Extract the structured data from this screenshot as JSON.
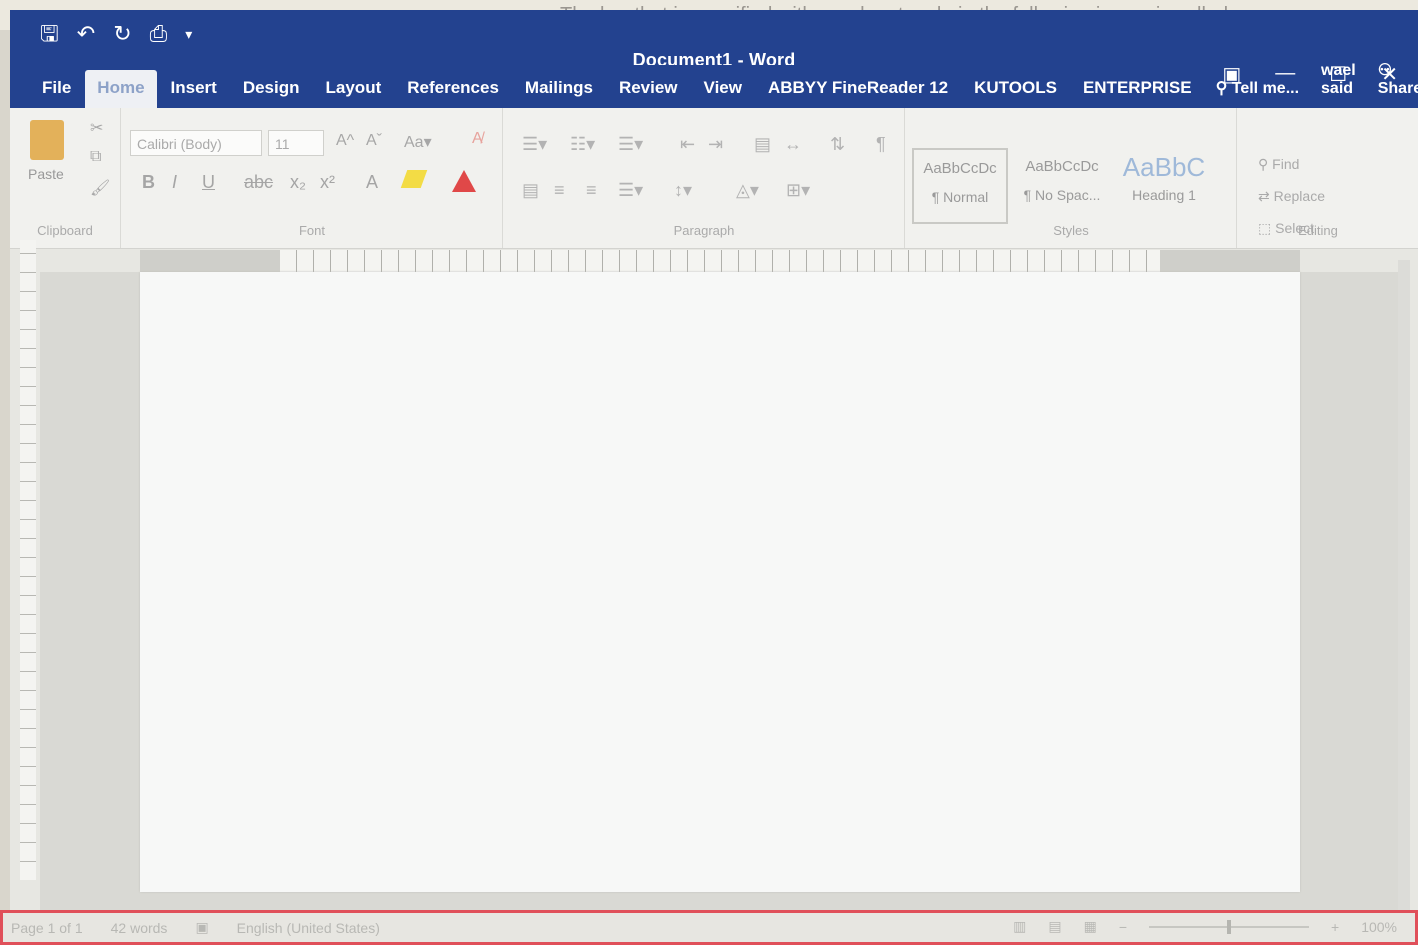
{
  "question_text": "The bar that is specified with a red rectangle in the following image is called",
  "window": {
    "title": "Document1 - Word"
  },
  "quick_access": {
    "icons": [
      "save-icon",
      "undo-icon",
      "redo-icon",
      "print-icon",
      "customize-icon"
    ]
  },
  "tabs": [
    "File",
    "Home",
    "Insert",
    "Design",
    "Layout",
    "References",
    "Mailings",
    "Review",
    "View",
    "ABBYY FineReader 12",
    "KUTOOLS",
    "ENTERPRISE"
  ],
  "active_tab": "Home",
  "tell_me": "Tell me...",
  "user_name": "wael said",
  "share_label": "Share",
  "ribbon": {
    "clipboard": {
      "paste_label": "Paste",
      "group_label": "Clipboard"
    },
    "font": {
      "font_name": "Calibri (Body)",
      "font_size": "11",
      "group_label": "Font"
    },
    "paragraph": {
      "group_label": "Paragraph"
    },
    "styles": {
      "group_label": "Styles",
      "items": [
        {
          "sample": "AaBbCcDc",
          "name": "¶ Normal"
        },
        {
          "sample": "AaBbCcDc",
          "name": "¶ No Spac..."
        },
        {
          "sample": "AaBbC",
          "name": "Heading 1"
        }
      ]
    },
    "editing": {
      "group_label": "Editing",
      "items": [
        "Find",
        "Replace",
        "Select"
      ]
    }
  },
  "status_bar": {
    "page": "Page 1 of 1",
    "words": "42 words",
    "language": "English (United States)",
    "zoom": "100%"
  },
  "colors": {
    "title_bar": "#23428f",
    "highlight_rectangle": "#e0505a",
    "font_color_button": "#e04848",
    "highlighter": "#f3dc45"
  }
}
